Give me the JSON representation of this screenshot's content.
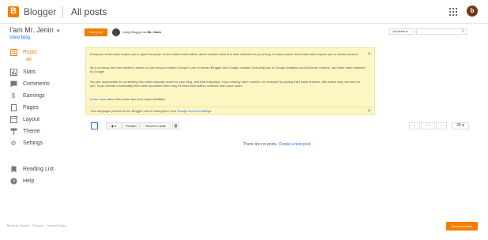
{
  "header": {
    "brand": "Blogger",
    "breadcrumb": "All posts",
    "avatar_letter": "b"
  },
  "sidebar": {
    "blog_name": "I'am Mr. Jenin",
    "view_blog": "View blog",
    "items": [
      {
        "label": "Posts",
        "icon": "posts-icon"
      },
      {
        "label": "Stats",
        "icon": "stats-icon"
      },
      {
        "label": "Comments",
        "icon": "comments-icon"
      },
      {
        "label": "Earnings",
        "icon": "earnings-icon"
      },
      {
        "label": "Pages",
        "icon": "pages-icon"
      },
      {
        "label": "Layout",
        "icon": "layout-icon"
      },
      {
        "label": "Theme",
        "icon": "theme-icon"
      },
      {
        "label": "Settings",
        "icon": "settings-icon"
      },
      {
        "label": "Reading List",
        "icon": "reading-list-icon"
      },
      {
        "label": "Help",
        "icon": "help-icon"
      }
    ],
    "sub_all": "All"
  },
  "main": {
    "new_post": "New post",
    "using_prefix": "Using Blogger as",
    "using_name": "Mr. Jenin",
    "labels_filter": "All labels",
    "notice": {
      "p1": "European Union laws require you to give European Union visitors information about cookies used and data collected on your blog. In many cases, these laws also require you to obtain consent.",
      "p2": "As a courtesy, we have added a notice on your blog to explain Google's use of certain Blogger and Google cookies, including use of Google Analytics and AdSense cookies, and other data collected by Google.",
      "p3": "You are responsible for confirming this notice actually works for your blog, and that it displays. If you employ other cookies, for example by adding third party features, this notice may not work for you. If you include functionality from other providers there may be extra information collected from your users.",
      "learn_more_link": "Learn more",
      "learn_more_rest": "about this notice and your responsibilities."
    },
    "notice2": {
      "prefix": "Your language preference for Blogger can be changed in your",
      "link": "Google Account settings"
    },
    "toolbar": {
      "publish": "Publish",
      "revert": "Revert to draft",
      "page_size": "25"
    },
    "empty_text": "There are no posts.",
    "empty_link": "Create a new post"
  },
  "footer": {
    "links": "Terms of Service  ·  Privacy  ·  Content Policy",
    "send_feedback": "Send feedback"
  },
  "colors": {
    "accent": "#f57d00",
    "link": "#1a73e8",
    "notice_bg": "#fdf6c3"
  }
}
